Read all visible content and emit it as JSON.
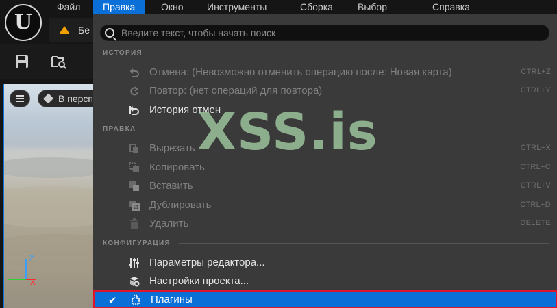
{
  "menubar": {
    "logo_letter": "U",
    "items": [
      {
        "label": "Файл"
      },
      {
        "label": "Правка"
      },
      {
        "label": "Окно"
      },
      {
        "label": "Инструменты"
      },
      {
        "label": "Сборка"
      },
      {
        "label": "Выбор"
      },
      {
        "label": "Справка"
      }
    ],
    "active_item": "Правка",
    "accent_color": "#0a70d8"
  },
  "tab": {
    "label": "Бе",
    "icon": "level-warning-icon"
  },
  "toolbar": {
    "icons": [
      "save-icon",
      "content-browser-icon"
    ]
  },
  "viewport": {
    "menu_icon": "hamburger-icon",
    "perspective_label": "В персп",
    "gizmo_axes": [
      "Z",
      "X"
    ]
  },
  "dropdown": {
    "search_placeholder": "Введите текст, чтобы начать поиск",
    "sections": {
      "history": {
        "title": "ИСТОРИЯ",
        "items": [
          {
            "label": "Отмена: (Невозможно отменить операцию после: Новая карта)",
            "shortcut": "CTRL+Z",
            "enabled": false,
            "icon": "undo-icon"
          },
          {
            "label": "Повтор: (нет операций для повтора)",
            "shortcut": "CTRL+Y",
            "enabled": false,
            "icon": "redo-icon"
          },
          {
            "label": "История отмен",
            "shortcut": "",
            "enabled": true,
            "icon": "undo-history-icon"
          }
        ]
      },
      "edit": {
        "title": "ПРАВКА",
        "items": [
          {
            "label": "Вырезать",
            "shortcut": "CTRL+X",
            "enabled": false,
            "icon": "cut-icon"
          },
          {
            "label": "Копировать",
            "shortcut": "CTRL+C",
            "enabled": false,
            "icon": "copy-icon"
          },
          {
            "label": "Вставить",
            "shortcut": "CTRL+V",
            "enabled": false,
            "icon": "paste-icon"
          },
          {
            "label": "Дублировать",
            "shortcut": "CTRL+D",
            "enabled": false,
            "icon": "duplicate-icon"
          },
          {
            "label": "Удалить",
            "shortcut": "DELETE",
            "enabled": false,
            "icon": "trash-icon"
          }
        ]
      },
      "config": {
        "title": "КОНФИГУРАЦИЯ",
        "items": [
          {
            "label": "Параметры редактора...",
            "shortcut": "",
            "enabled": true,
            "icon": "sliders-icon"
          },
          {
            "label": "Настройки проекта...",
            "shortcut": "",
            "enabled": true,
            "icon": "project-settings-icon"
          },
          {
            "label": "Плагины",
            "shortcut": "",
            "enabled": true,
            "icon": "plugin-icon",
            "highlighted": true,
            "checked": true
          }
        ]
      }
    },
    "highlight_border_color": "#e0152a"
  },
  "watermark": {
    "text": "XSS.is"
  }
}
